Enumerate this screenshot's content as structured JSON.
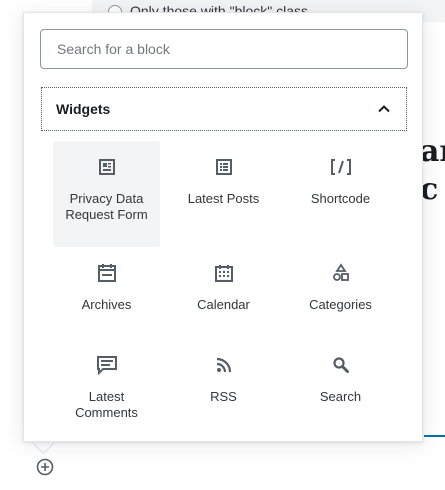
{
  "background": {
    "radio_label": "Only those with \"block\" class",
    "heading_line1": "ar",
    "heading_line2": "c I"
  },
  "inserter": {
    "search_placeholder": "Search for a block",
    "search_value": "",
    "panel_title": "Widgets",
    "panel_expanded": true,
    "blocks": [
      {
        "label": "Privacy Data Request Form",
        "icon": "privacy-form-icon",
        "active": true
      },
      {
        "label": "Latest Posts",
        "icon": "latest-posts-icon",
        "active": false
      },
      {
        "label": "Shortcode",
        "icon": "shortcode-icon",
        "active": false
      },
      {
        "label": "Archives",
        "icon": "archives-icon",
        "active": false
      },
      {
        "label": "Calendar",
        "icon": "calendar-icon",
        "active": false
      },
      {
        "label": "Categories",
        "icon": "categories-icon",
        "active": false
      },
      {
        "label": "Latest Comments",
        "icon": "latest-comments-icon",
        "active": false
      },
      {
        "label": "RSS",
        "icon": "rss-icon",
        "active": false
      },
      {
        "label": "Search",
        "icon": "search-icon",
        "active": false
      }
    ]
  },
  "colors": {
    "accent": "#0073aa",
    "icon": "#555d66",
    "hover_bg": "#f3f4f5"
  }
}
